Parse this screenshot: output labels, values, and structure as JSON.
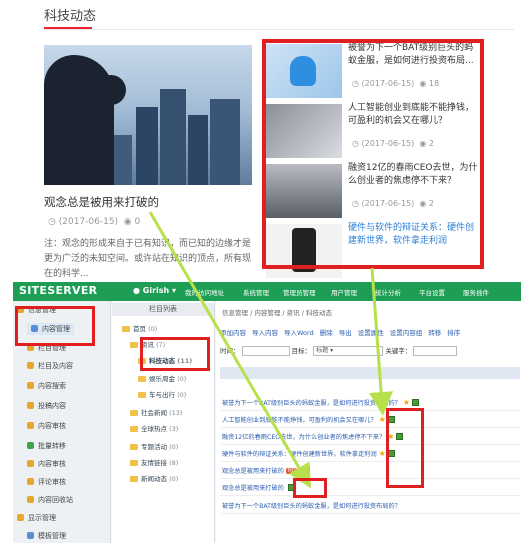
{
  "news": {
    "section_title": "科技动态",
    "hero": {
      "title": "观念总是被用来打破的",
      "date": "(2017-06-15)",
      "views": "0",
      "desc": "注：观念的形成来自于已有知识，而已知的边缘才是更为广泛的未知空间。或许站在知识的顶点，所有现在的科学..."
    },
    "items": [
      {
        "title": "被誉为下一个BAT级别巨头的蚂蚁金服，是如何进行投资布局...",
        "date": "(2017-06-15)",
        "views": "18"
      },
      {
        "title": "人工智能创业到底能不能挣钱，可盈利的机会又在哪儿？",
        "date": "(2017-06-15)",
        "views": "2"
      },
      {
        "title": "融资12亿的春雨CEO去世，为什么创业者的焦虑停不下来？",
        "date": "(2017-06-15)",
        "views": "2"
      },
      {
        "title": "硬件与软件的辩证关系：硬件创建新世界，软件拿走利润",
        "date": "",
        "views": ""
      }
    ]
  },
  "cms": {
    "logo": "SITESERVER",
    "site_label": "Girish",
    "top_nav": [
      "我的访问地址",
      "系统管理",
      "管理员管理",
      "用户管理",
      "统计分析",
      "平台设置",
      "服务插件"
    ],
    "sidebar": [
      {
        "label": "信息管理",
        "color": "#e5a72c"
      },
      {
        "label": "内容管理",
        "color": "#5b8dd6"
      },
      {
        "label": "栏目管理",
        "color": "#e5a72c"
      },
      {
        "label": "栏目及内容",
        "color": "#e5a72c"
      },
      {
        "label": "内容搜索",
        "color": "#e5a72c"
      },
      {
        "label": "投稿内容",
        "color": "#e5a72c"
      },
      {
        "label": "内容审核",
        "color": "#e5a72c"
      },
      {
        "label": "批量转移",
        "color": "#3fa34d"
      },
      {
        "label": "内容审核",
        "color": "#e5a72c"
      },
      {
        "label": "评论审核",
        "color": "#e5a72c"
      },
      {
        "label": "内容回收站",
        "color": "#e5a72c"
      },
      {
        "label": "显示管理",
        "color": "#e5a72c"
      },
      {
        "label": "模板管理",
        "color": "#5b8dd6"
      }
    ],
    "tree_head": "栏目列表",
    "tree": [
      {
        "label": "首页",
        "count": "(0)"
      },
      {
        "label": "资讯",
        "count": "(7)"
      },
      {
        "label": "科技动态",
        "count": "(11)"
      },
      {
        "label": "娱乐周金",
        "count": "(0)"
      },
      {
        "label": "车与出行",
        "count": "(0)"
      },
      {
        "label": "社会新闻",
        "count": "(13)"
      },
      {
        "label": "全球热点",
        "count": "(3)"
      },
      {
        "label": "专题活动",
        "count": "(0)"
      },
      {
        "label": "友情链接",
        "count": "(8)"
      },
      {
        "label": "新闻动态",
        "count": "(0)"
      }
    ],
    "breadcrumb": "信息管理 / 内容管理 / 资讯 / 科技动态",
    "toolbar": [
      "添加内容",
      "导入内容",
      "导入Word",
      "删除",
      "导出",
      "设置属性",
      "设置内容组",
      "转移",
      "排序"
    ],
    "filter": {
      "time_label": "时间：",
      "target_label": "目标：",
      "target_value": "标题",
      "keyword_label": "关键字："
    },
    "rows": [
      "被誉为下一个BAT级别巨头的蚂蚁金服，是如何进行投资布局的？",
      "人工智能创业到底能不能挣钱，可盈利的机会又在哪儿？",
      "融资12亿的春雨CEO去世，为什么创业者的焦虑停不下来？",
      "硬件与软件的辩证关系：硬件创建新世界，软件拿走利润",
      "观念总是被用来打破的",
      "观念总是被用来打破的",
      "被誉为下一个BAT级别巨头的蚂蚁金服，是如何进行投资布局的？"
    ],
    "hot_badge": "HOT"
  },
  "colors": {
    "accent_red": "#e02020",
    "cms_green": "#1d9e54",
    "arrow_green": "#b8e04a"
  }
}
